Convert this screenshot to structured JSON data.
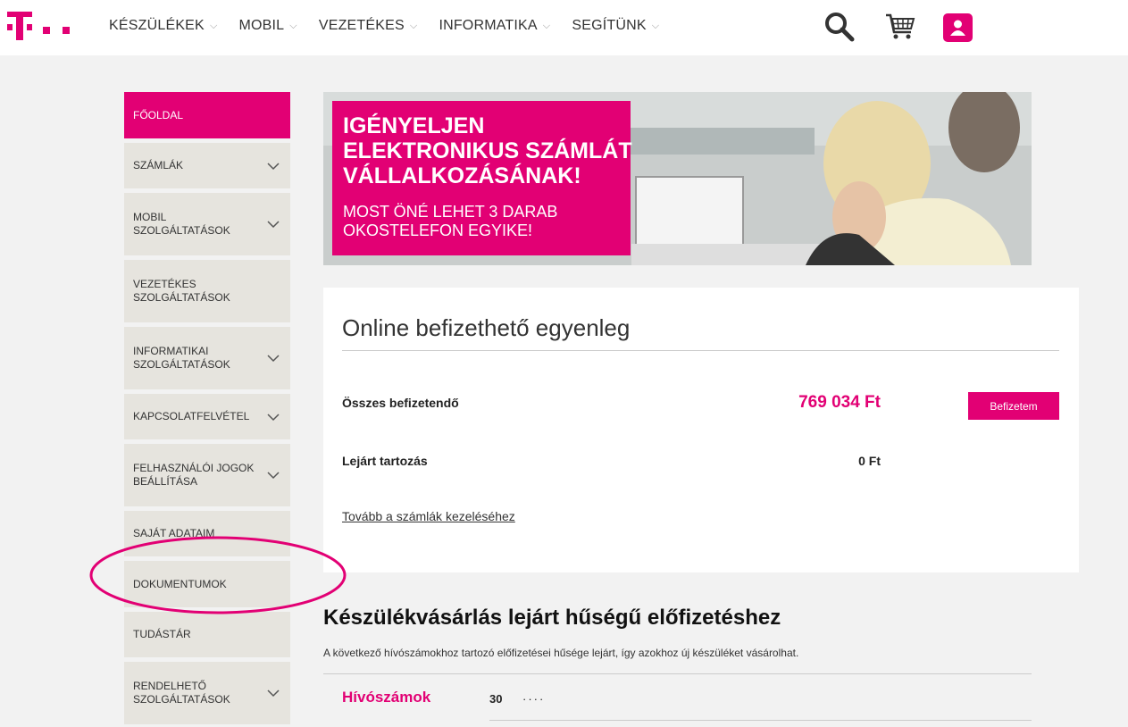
{
  "header": {
    "nav": [
      {
        "label": "KÉSZÜLÉKEK"
      },
      {
        "label": "MOBIL"
      },
      {
        "label": "VEZETÉKES"
      },
      {
        "label": "INFORMATIKA"
      },
      {
        "label": "SEGÍTÜNK"
      }
    ],
    "icons": [
      "search-icon",
      "cart-icon",
      "user-icon"
    ]
  },
  "sidebar": {
    "items": [
      {
        "label": "FŐOLDAL",
        "active": true,
        "has_chevron": false
      },
      {
        "label": "SZÁMLÁK",
        "has_chevron": true
      },
      {
        "label": "MOBIL\nSZOLGÁLTATÁSOK",
        "has_chevron": true
      },
      {
        "label": "VEZETÉKES\nSZOLGÁLTATÁSOK",
        "has_chevron": false
      },
      {
        "label": "INFORMATIKAI\nSZOLGÁLTATÁSOK",
        "has_chevron": true
      },
      {
        "label": "KAPCSOLATFELVÉTEL",
        "has_chevron": true
      },
      {
        "label": "FELHASZNÁLÓI JOGOK\nBEÁLLÍTÁSA",
        "has_chevron": true
      },
      {
        "label": "SAJÁT ADATAIM",
        "has_chevron": false
      },
      {
        "label": "DOKUMENTUMOK",
        "has_chevron": false
      },
      {
        "label": "TUDÁSTÁR",
        "has_chevron": false
      },
      {
        "label": "RENDELHETŐ\nSZOLGÁLTATÁSOK",
        "has_chevron": true
      }
    ]
  },
  "banner": {
    "headline": "IGÉNYELJEN\nELEKTRONIKUS SZÁMLÁT\nVÁLLALKOZÁSÁNAK!",
    "subline": "MOST ÖNÉ LEHET 3 DARAB\nOKOSTELEFON EGYIKE!"
  },
  "balance": {
    "title": "Online befizethető egyenleg",
    "total_label": "Összes befizetendő",
    "total_value": "769 034 Ft",
    "pay_button": "Befizetem",
    "overdue_label": "Lejárt tartozás",
    "overdue_value": "0 Ft",
    "more_link": "Tovább a számlák kezeléséhez"
  },
  "device_section": {
    "title": "Készülékvásárlás lejárt hűségű előfizetéshez",
    "description": "A következő hívószámokhoz tartozó előfizetései hűsége lejárt, így azokhoz új készüléket vásárolhat.",
    "phones_label": "Hívószámok",
    "phone_prefix": "30",
    "phone_masked": "····"
  },
  "colors": {
    "brand": "#e20074",
    "sidebar_bg": "#e6e4de",
    "page_bg": "#f2f2f2"
  }
}
